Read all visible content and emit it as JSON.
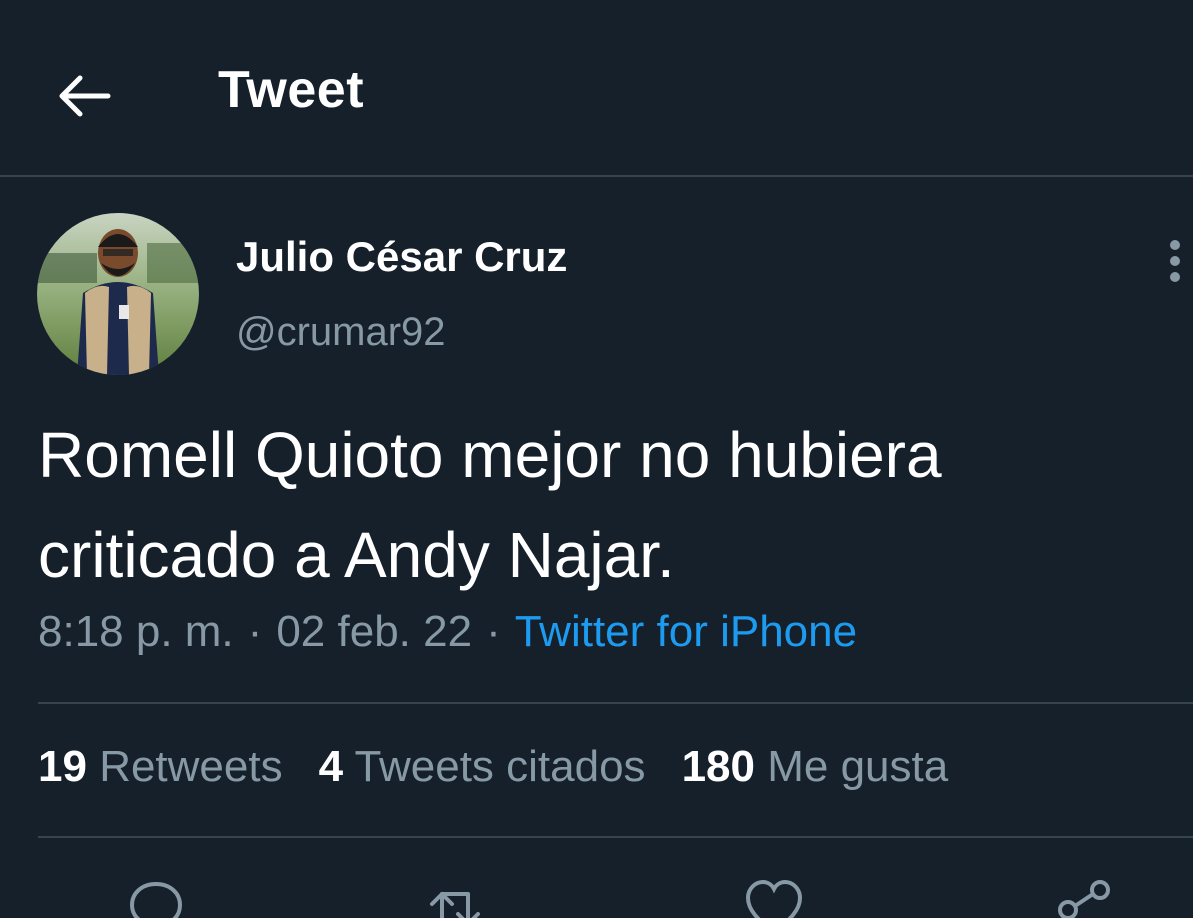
{
  "header": {
    "title": "Tweet",
    "back_icon": "arrow-left-icon"
  },
  "author": {
    "name": "Julio César Cruz",
    "handle": "@crumar92"
  },
  "tweet": {
    "text_line1": "Romell Quioto mejor no hubiera",
    "text_line2": "criticado a Andy Najar.",
    "time": "8:18 p. m.",
    "date": "02 feb. 22",
    "separator": "·",
    "source": "Twitter for iPhone"
  },
  "stats": {
    "retweets_count": "19",
    "retweets_label": "Retweets",
    "quotes_count": "4",
    "quotes_label": "Tweets citados",
    "likes_count": "180",
    "likes_label": "Me gusta"
  },
  "actions": [
    "reply-icon",
    "retweet-icon",
    "like-icon",
    "share-icon"
  ],
  "colors": {
    "background": "#15202b",
    "divider": "#38444d",
    "secondary_text": "#8899a6",
    "link": "#1d9bf0"
  }
}
